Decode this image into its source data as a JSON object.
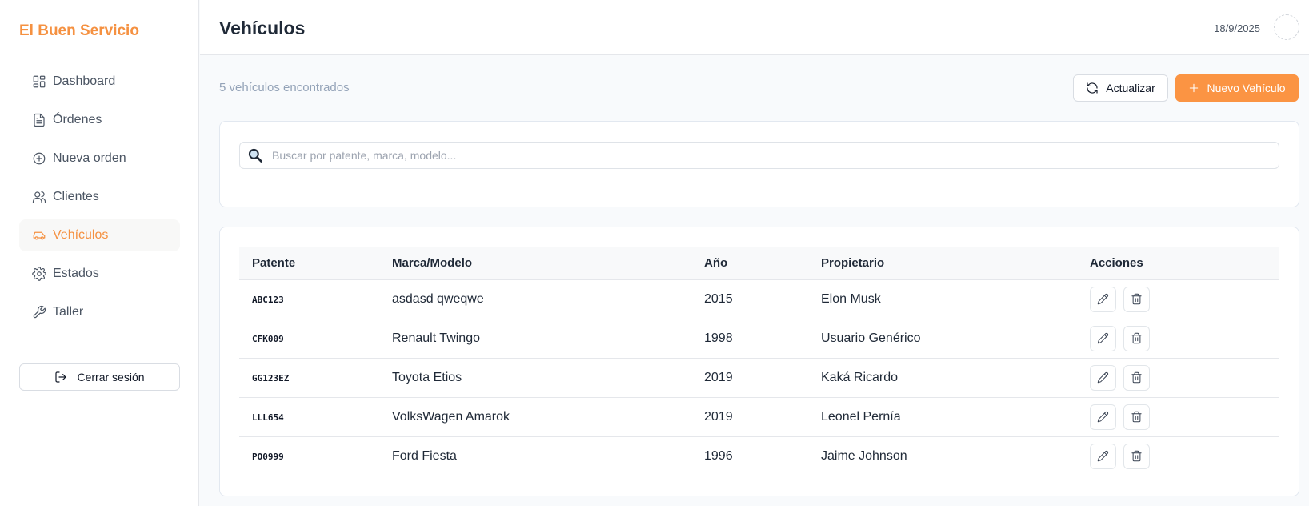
{
  "brand": "El Buen Servicio",
  "nav": [
    {
      "label": "Dashboard",
      "icon": "dashboard-icon"
    },
    {
      "label": "Órdenes",
      "icon": "document-icon"
    },
    {
      "label": "Nueva orden",
      "icon": "plus-circle-icon"
    },
    {
      "label": "Clientes",
      "icon": "users-icon"
    },
    {
      "label": "Vehículos",
      "icon": "car-icon",
      "active": true
    },
    {
      "label": "Estados",
      "icon": "gear-icon"
    },
    {
      "label": "Taller",
      "icon": "wrench-icon"
    }
  ],
  "logout_label": "Cerrar sesión",
  "header": {
    "title": "Vehículos",
    "date": "18/9/2025"
  },
  "toolbar": {
    "count_text": "5 vehículos encontrados",
    "refresh_label": "Actualizar",
    "new_label": "Nuevo Vehículo"
  },
  "search": {
    "placeholder": "Buscar por patente, marca, modelo...",
    "value": ""
  },
  "table": {
    "columns": [
      "Patente",
      "Marca/Modelo",
      "Año",
      "Propietario",
      "Acciones"
    ],
    "rows": [
      {
        "patente": "ABC123",
        "marca_modelo": "asdasd qweqwe",
        "anio": "2015",
        "propietario": "Elon Musk"
      },
      {
        "patente": "CFK009",
        "marca_modelo": "Renault Twingo",
        "anio": "1998",
        "propietario": "Usuario Genérico"
      },
      {
        "patente": "GG123EZ",
        "marca_modelo": "Toyota Etios",
        "anio": "2019",
        "propietario": "Kaká Ricardo"
      },
      {
        "patente": "LLL654",
        "marca_modelo": "VolksWagen Amarok",
        "anio": "2019",
        "propietario": "Leonel Pernía"
      },
      {
        "patente": "PO0999",
        "marca_modelo": "Ford Fiesta",
        "anio": "1996",
        "propietario": "Jaime Johnson"
      }
    ]
  },
  "colors": {
    "accent": "#fb9443",
    "brand": "#f59141",
    "muted_text": "#94a3b8"
  }
}
